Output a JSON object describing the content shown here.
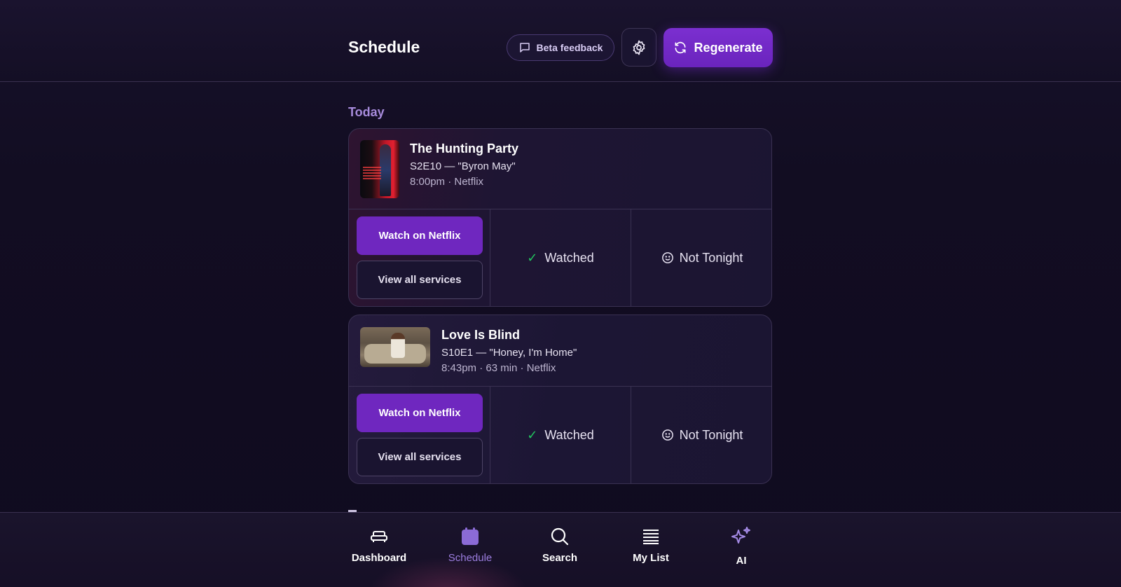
{
  "header": {
    "title": "Schedule",
    "beta_feedback_label": "Beta feedback",
    "regenerate_label": "Regenerate"
  },
  "section": {
    "label": "Today"
  },
  "items": [
    {
      "title": "The Hunting Party",
      "episode": "S2E10 — \"Byron May\"",
      "meta": "8:00pm  · Netflix",
      "watch_label": "Watch on Netflix",
      "services_label": "View all services",
      "watched_label": "Watched",
      "not_tonight_label": "Not Tonight"
    },
    {
      "title": "Love Is Blind",
      "episode": "S10E1 — \"Honey, I'm Home\"",
      "meta": "8:43pm  · 63 min  · Netflix",
      "watch_label": "Watch on Netflix",
      "services_label": "View all services",
      "watched_label": "Watched",
      "not_tonight_label": "Not Tonight"
    }
  ],
  "nav": {
    "items": [
      {
        "label": "Dashboard",
        "icon": "couch-icon"
      },
      {
        "label": "Schedule",
        "icon": "calendar-icon",
        "active": true
      },
      {
        "label": "Search",
        "icon": "search-icon"
      },
      {
        "label": "My List",
        "icon": "list-icon"
      },
      {
        "label": "AI",
        "icon": "sparkles-icon"
      }
    ]
  },
  "colors": {
    "accent": "#6f27bf",
    "active_nav": "#9d7ee0",
    "check": "#22c55e",
    "background": "#120d22"
  }
}
